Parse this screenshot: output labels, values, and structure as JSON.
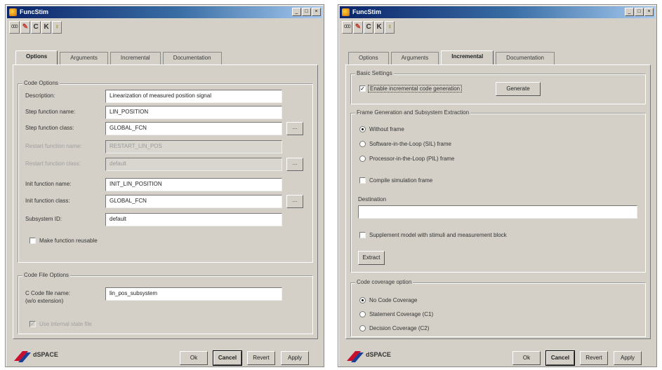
{
  "app": {
    "title": "FuncStim"
  },
  "window_buttons": {
    "minimize": "_",
    "maximize": "□",
    "close": "×"
  },
  "toolbar": {
    "item1": "000",
    "item2": "✎",
    "item3": "C",
    "item4": "K",
    "item5": "♀"
  },
  "tabs": [
    "Options",
    "Arguments",
    "Incremental",
    "Documentation"
  ],
  "options": {
    "code_options_label": "Code Options",
    "rows": [
      {
        "label": "Description:",
        "value": "Linearization of measured position signal"
      },
      {
        "label": "Step function name:",
        "value": "LIN_POSITION"
      },
      {
        "label": "Step function class:",
        "value": "GLOBAL_FCN"
      },
      {
        "label": "Restart function name:",
        "value": "RESTART_LIN_POS"
      },
      {
        "label": "Restart function class:",
        "value": "default"
      },
      {
        "label": "Init function name:",
        "value": "INIT_LIN_POSITION"
      },
      {
        "label": "Init function class:",
        "value": "GLOBAL_FCN"
      },
      {
        "label": "Subsystem ID:",
        "value": "default"
      }
    ],
    "dots_label": "...",
    "reusable_label": "Make function reusable",
    "code_file_options_label": "Code File Options",
    "c_code_file_label": "C Code file name:",
    "c_code_file_sub": "(w/o extension)",
    "c_code_file_value": "lin_pos_subsystem",
    "disabled_check_label": "Use internal state file"
  },
  "incremental": {
    "basic_settings_label": "Basic Settings",
    "enable_label": "Enable incremental code generation",
    "generate_label": "Generate",
    "frame_label": "Frame Generation and Subsystem Extraction",
    "radio_without": "Without frame",
    "radio_sil": "Software-in-the-Loop (SIL) frame",
    "radio_pil": "Processor-in-the-Loop (PIL) frame",
    "compile_label": "Compile simulation frame",
    "destination_label": "Destination",
    "destination_value": "",
    "supplement_label": "Supplement model with stimuli and measurement block",
    "extract_label": "Extract",
    "coverage_label": "Code coverage option",
    "radio_no_cov": "No Code Coverage",
    "radio_c1": "Statement Coverage (C1)",
    "radio_c2": "Decision Coverage (C2)"
  },
  "footer": {
    "logo_text": "dSPACE",
    "ok": "Ok",
    "cancel": "Cancel",
    "revert": "Revert",
    "apply": "Apply"
  }
}
